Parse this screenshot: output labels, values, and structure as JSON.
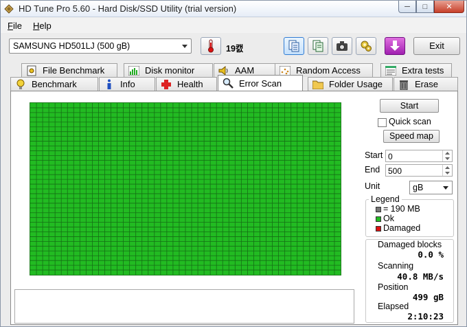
{
  "window": {
    "title": "HD Tune Pro 5.60 - Hard Disk/SSD Utility (trial version)",
    "min_glyph": "─",
    "max_glyph": "□",
    "close_glyph": "✕"
  },
  "menu": [
    {
      "ul": "F",
      "rest": "ile"
    },
    {
      "ul": "H",
      "rest": "elp"
    }
  ],
  "toolbar": {
    "drive": "SAMSUNG HD501LJ (500 gB)",
    "temperature": "19캜",
    "exit_label": "Exit"
  },
  "tabs_row1": [
    "File Benchmark",
    "Disk monitor",
    "AAM",
    "Random Access",
    "Extra tests"
  ],
  "tabs_row2": [
    "Benchmark",
    "Info",
    "Health",
    "Error Scan",
    "Folder Usage",
    "Erase"
  ],
  "active_tab": "Error Scan",
  "controls": {
    "start_label": "Start",
    "quick_scan_label": "Quick scan",
    "quick_scan_checked": false,
    "speed_map_label": "Speed map",
    "start_field_label": "Start",
    "start_value": "0",
    "end_field_label": "End",
    "end_value": "500",
    "unit_label": "Unit",
    "unit_value": "gB"
  },
  "legend": {
    "title": "Legend",
    "block_size": "= 190 MB",
    "ok": "Ok",
    "damaged": "Damaged",
    "colors": {
      "block": "#777777",
      "ok": "#22bb22",
      "damaged": "#dd1111"
    }
  },
  "stats": {
    "damaged_blocks_label": "Damaged blocks",
    "damaged_blocks_value": "0.0 %",
    "scanning_label": "Scanning",
    "scanning_value": "40.8 MB/s",
    "position_label": "Position",
    "position_value": "499 gB",
    "elapsed_label": "Elapsed",
    "elapsed_value": "2:10:23"
  },
  "scan_map": {
    "all_ok": true,
    "color": "#22bb22",
    "grid_color": "#156f15"
  }
}
